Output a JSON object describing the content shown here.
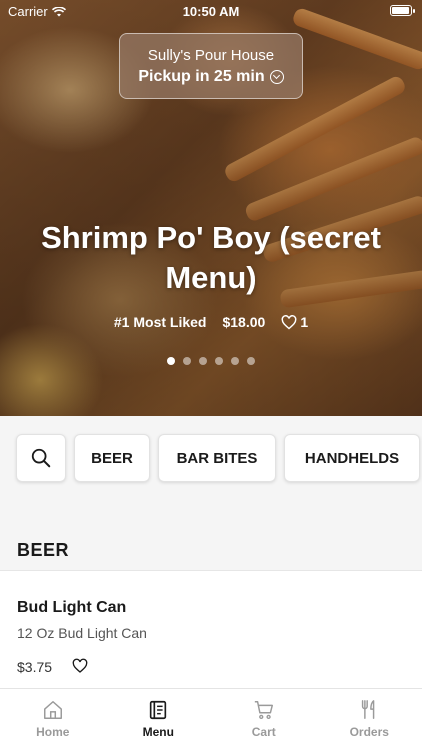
{
  "status_bar": {
    "carrier": "Carrier",
    "time": "10:50 AM",
    "battery_level": 1.0
  },
  "store": {
    "name": "Sully's Pour House",
    "pickup": "Pickup in 25 min"
  },
  "featured": {
    "title": "Shrimp Po' Boy (secret Menu)",
    "badge": "#1 Most Liked",
    "price": "$18.00",
    "likes": "1",
    "carousel_count": 6,
    "carousel_active": 1
  },
  "categories": [
    {
      "label": "BEER"
    },
    {
      "label": "BAR BITES"
    },
    {
      "label": "HANDHELDS"
    }
  ],
  "section": {
    "title": "BEER"
  },
  "items": [
    {
      "name": "Bud Light Can",
      "description": "12 Oz  Bud Light Can",
      "price": "$3.75"
    }
  ],
  "tabs": [
    {
      "label": "Home",
      "icon": "home-icon",
      "active": false
    },
    {
      "label": "Menu",
      "icon": "menu-icon",
      "active": true
    },
    {
      "label": "Cart",
      "icon": "cart-icon",
      "active": false
    },
    {
      "label": "Orders",
      "icon": "fork-knife-icon",
      "active": false
    }
  ],
  "colors": {
    "active_tab": "#1a1a1a",
    "inactive_tab": "#9a9a9a"
  }
}
